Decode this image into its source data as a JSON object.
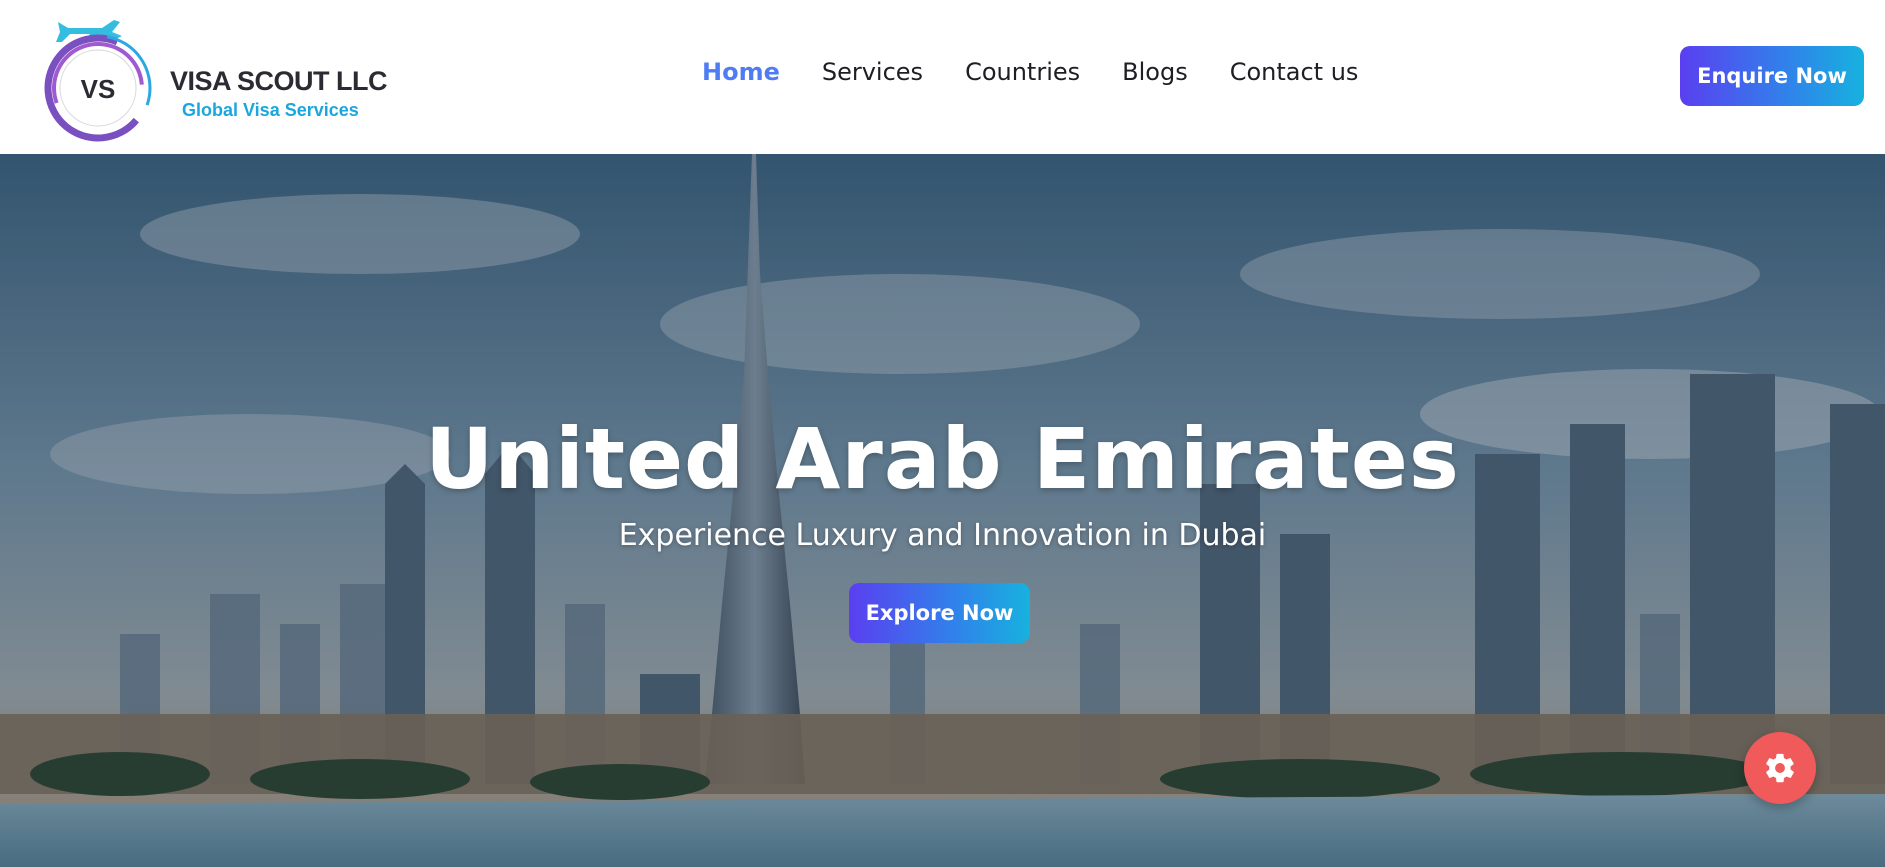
{
  "brand": {
    "monogram": "VS",
    "name": "VISA SCOUT LLC",
    "tagline": "Global Visa Services"
  },
  "nav": {
    "items": [
      {
        "label": "Home",
        "active": true
      },
      {
        "label": "Services",
        "active": false
      },
      {
        "label": "Countries",
        "active": false
      },
      {
        "label": "Blogs",
        "active": false
      },
      {
        "label": "Contact us",
        "active": false
      }
    ],
    "cta_label": "Enquire Now"
  },
  "hero": {
    "title": "United Arab Emirates",
    "subtitle": "Experience Luxury and Innovation in Dubai",
    "button_label": "Explore Now"
  },
  "fab": {
    "icon": "gear-icon"
  },
  "colors": {
    "accent_blue": "#4f7cf3",
    "gradient_start": "#5a3ff0",
    "gradient_end": "#17b2de",
    "fab_red": "#f05a5a",
    "brand_cyan": "#1aa6df"
  }
}
